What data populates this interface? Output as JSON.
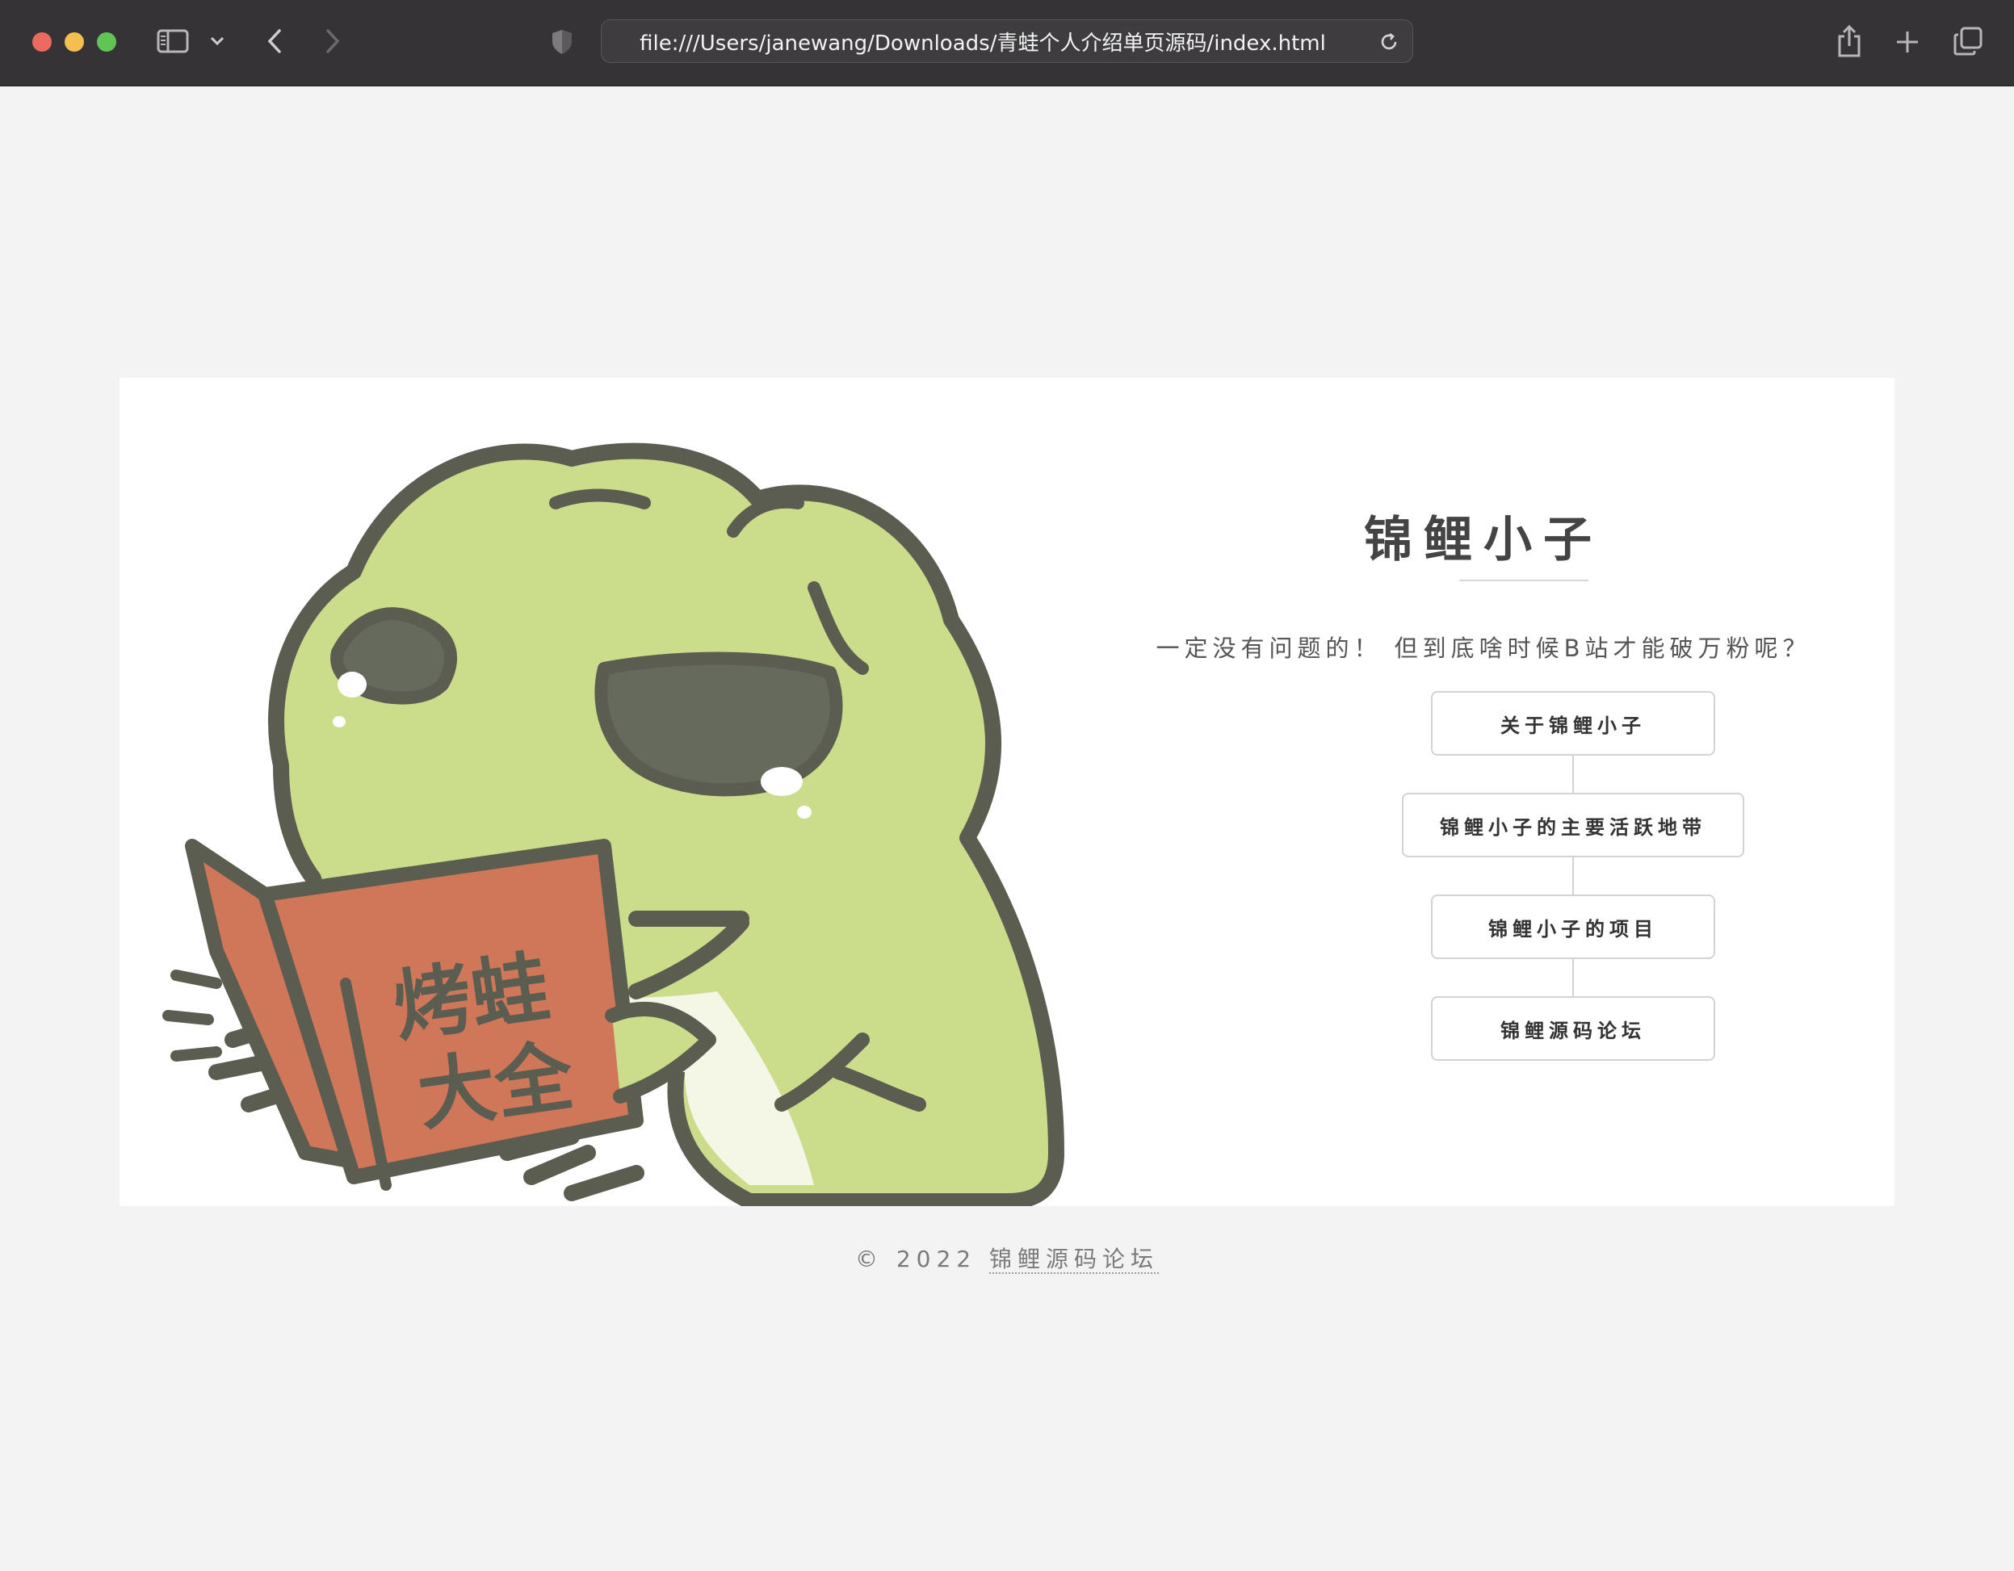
{
  "browser": {
    "url": "file:///Users/janewang/Downloads/青蛙个人介绍单页源码/index.html"
  },
  "site": {
    "title": "锦鲤小子",
    "tagline": "一定没有问题的！ 但到底啥时候B站才能破万粉呢？",
    "nav": [
      {
        "label": "关于锦鲤小子"
      },
      {
        "label": "锦鲤小子的主要活跃地带"
      },
      {
        "label": "锦鲤小子的项目"
      },
      {
        "label": "锦鲤源码论坛"
      }
    ],
    "illustration": {
      "book_text_line1": "烤蛙",
      "book_text_line2": "大全"
    }
  },
  "footer": {
    "copyright": "© 2022",
    "link_label": "锦鲤源码论坛"
  },
  "colors": {
    "page_bg": "#f4f3f4",
    "card_bg": "#ffffff",
    "frog_green": "#cbdc8a",
    "frog_outline": "#5a5d50",
    "book_red": "#d0775a"
  }
}
